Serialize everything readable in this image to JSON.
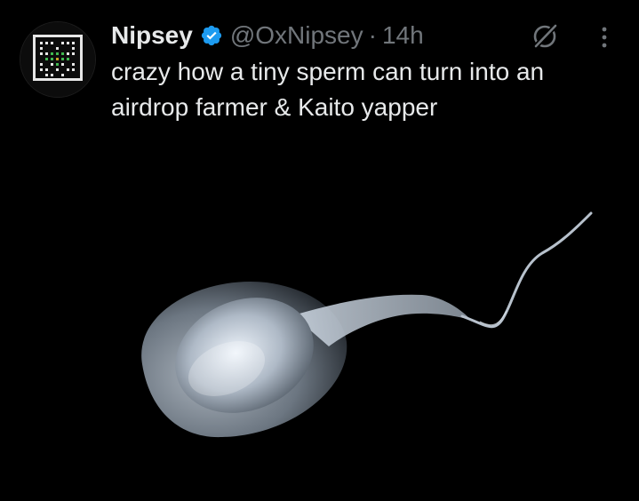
{
  "post": {
    "author": {
      "display_name": "Nipsey",
      "handle": "@OxNipsey",
      "verified": true,
      "avatar_icon": "pixel-art-avatar-icon"
    },
    "separator": "·",
    "timestamp": "14h",
    "text_lines": [
      "crazy how a tiny sperm can turn into an",
      "airdrop farmer & Kaito yapper"
    ],
    "actions": {
      "grok_icon": "grok-icon",
      "more_icon": "more-options-icon"
    },
    "media": {
      "type": "image",
      "icon": "sperm-cell-illustration"
    }
  },
  "colors": {
    "background": "#000000",
    "primary_text": "#e7e9ea",
    "secondary_text": "#71767b",
    "verified_badge": "#1d9bf0"
  }
}
